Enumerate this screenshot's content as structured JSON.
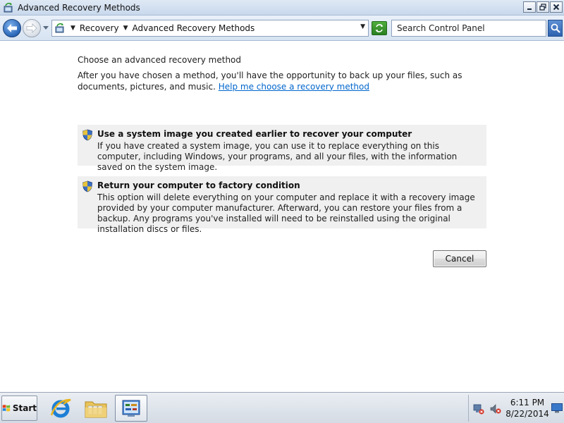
{
  "window": {
    "title": "Advanced Recovery Methods",
    "buttons": {
      "minimize": "_",
      "maximize": "□",
      "close": "✕"
    }
  },
  "address_bar": {
    "breadcrumbs": [
      "Recovery",
      "Advanced Recovery Methods"
    ],
    "search_placeholder": "Search Control Panel"
  },
  "main": {
    "heading": "Choose an advanced recovery method",
    "description": "After you have chosen a method, you'll have the opportunity to back up your files, such as documents, pictures, and music.",
    "help_link": "Help me choose a recovery method",
    "options": [
      {
        "title": "Use a system image you created earlier to recover your computer",
        "description": "If you have created a system image, you can use it to replace everything on this computer, including Windows, your programs, and all your files, with the information saved on the system image."
      },
      {
        "title": "Return your computer to factory condition",
        "description": "This option will delete everything on your computer and replace it with a recovery image provided by your computer manufacturer. Afterward, you can restore your files from a backup. Any programs you've installed will need to be reinstalled using the original installation discs or files."
      }
    ],
    "cancel_label": "Cancel"
  },
  "taskbar": {
    "start_label": "Start",
    "apps": [
      "internet-explorer-icon",
      "windows-explorer-icon",
      "control-panel-icon"
    ],
    "clock": {
      "time": "6:11 PM",
      "date": "8/22/2014"
    }
  },
  "colors": {
    "link": "#0066cc",
    "option_background": "#f0f0f0",
    "titlebar": "#dfe9f5"
  }
}
